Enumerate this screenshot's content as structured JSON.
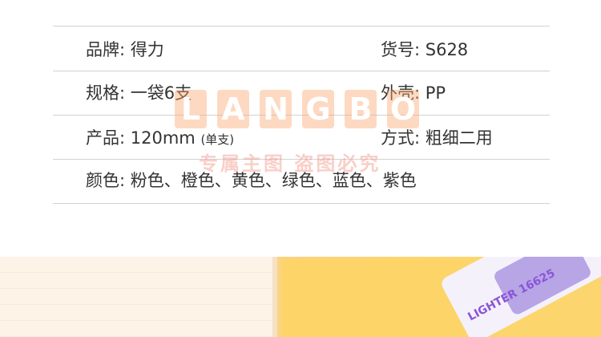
{
  "specs": [
    {
      "left": "品牌: 得力",
      "right": "货号: S628"
    },
    {
      "left": "规格: 一袋6支",
      "right": "外壳: PP"
    },
    {
      "left_main": "产品: 120mm",
      "left_small": "(单支)",
      "right": "方式: 粗细二用"
    },
    {
      "left": "颜色: 粉色、橙色、黄色、绿色、蓝色、紫色"
    }
  ],
  "watermark": {
    "letters": [
      "L",
      "A",
      "N",
      "G",
      "B",
      "O"
    ],
    "subtitle": "专属主图  盗图必究"
  },
  "photo": {
    "marker_label": "LIGHTER",
    "marker_code": "16625"
  },
  "colors": {
    "divider": "#d2d2d2",
    "text": "#333333",
    "watermark": "#faa56e",
    "yellow": "#fdd468",
    "marker_cap": "#b7a5e6"
  }
}
